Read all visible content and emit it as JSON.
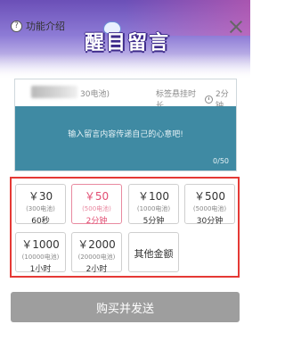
{
  "header": {
    "help_label": "功能介绍",
    "title": "醒目留言",
    "help_icon": "question-circle-icon",
    "close_icon": "close-icon"
  },
  "message_card": {
    "amount_hint": "30电池)",
    "duration_label": "标签悬挂时长",
    "duration_value": "2分钟",
    "placeholder": "输入留言内容传递自己的心意吧!",
    "char_count": "0/50",
    "body_color": "#3f8aa3"
  },
  "options": [
    {
      "price": "￥30",
      "coins": "(300电池)",
      "time": "60秒",
      "selected": false
    },
    {
      "price": "￥50",
      "coins": "(500电池)",
      "time": "2分钟",
      "selected": true
    },
    {
      "price": "￥100",
      "coins": "(1000电池)",
      "time": "5分钟",
      "selected": false
    },
    {
      "price": "￥500",
      "coins": "(5000电池)",
      "time": "30分钟",
      "selected": false
    },
    {
      "price": "￥1000",
      "coins": "(10000电池)",
      "time": "1小时",
      "selected": false
    },
    {
      "price": "￥2000",
      "coins": "(20000电池)",
      "time": "2小时",
      "selected": false
    }
  ],
  "other_amount_label": "其他金额",
  "buy_button_label": "购买并发送",
  "colors": {
    "accent_pink": "#e24e73",
    "highlight_red": "#e53935",
    "button_gray": "#9e9e9e"
  }
}
